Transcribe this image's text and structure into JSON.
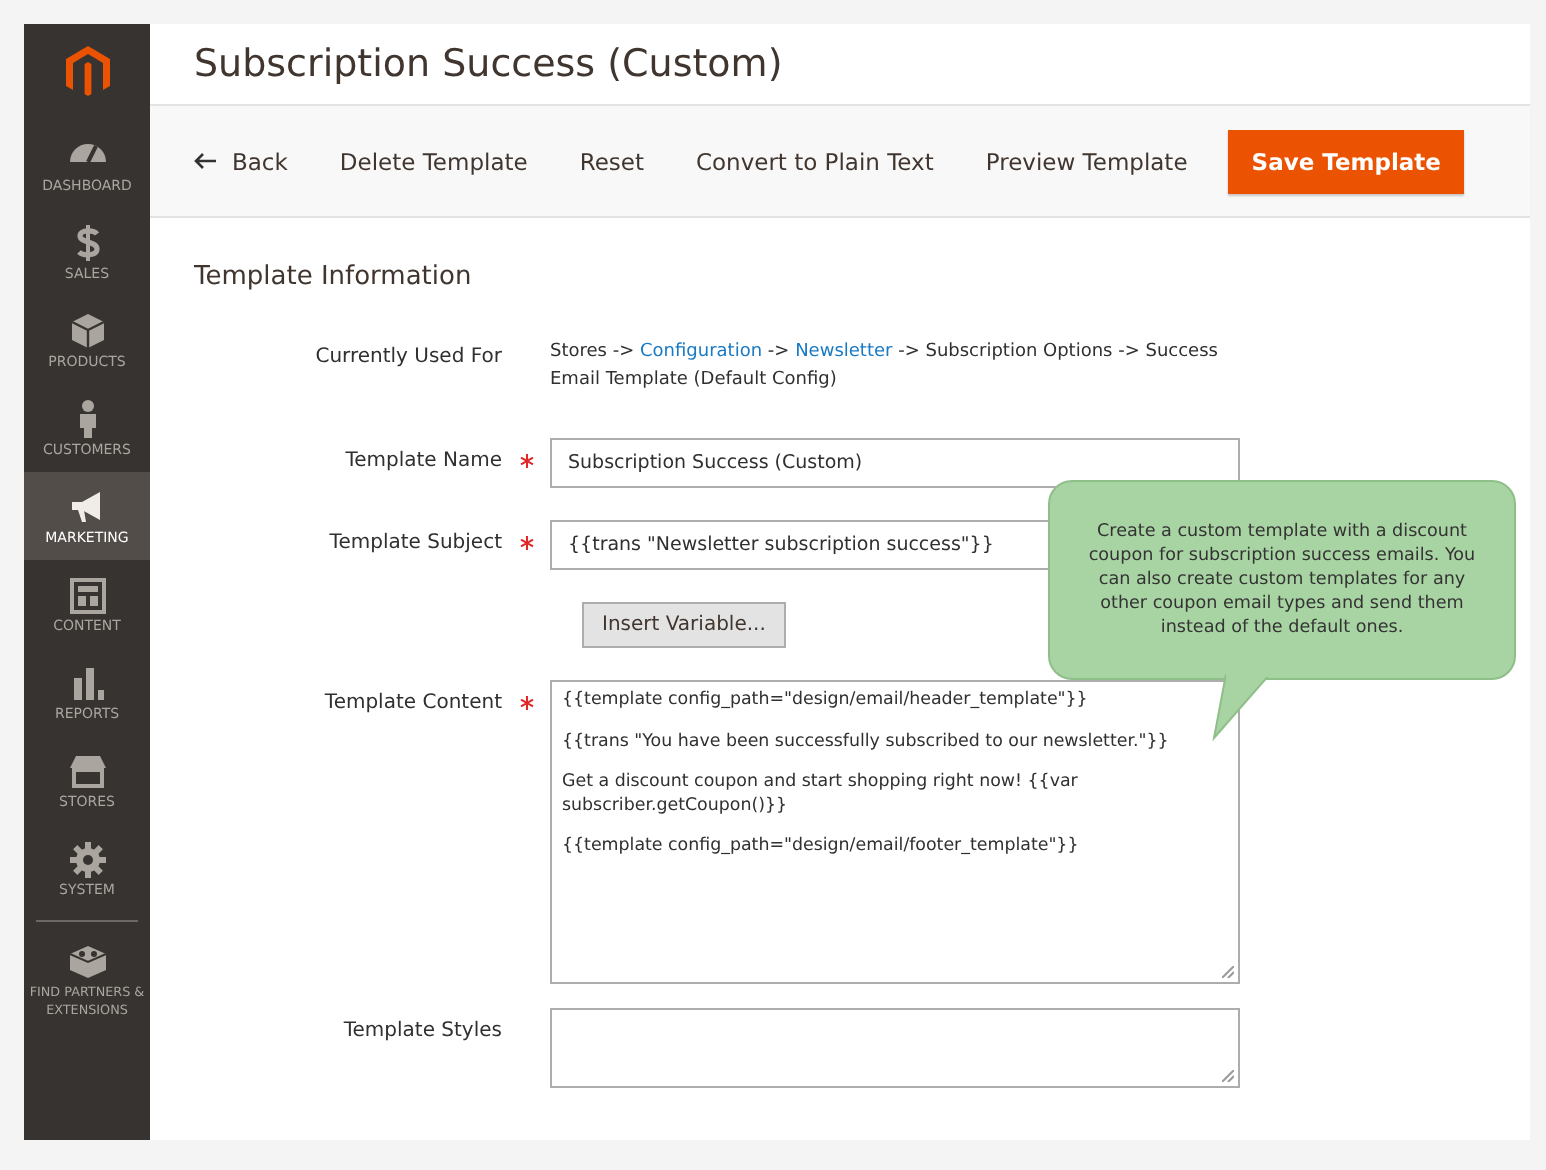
{
  "sidebar": {
    "items": [
      {
        "label": "DASHBOARD",
        "selected": false
      },
      {
        "label": "SALES",
        "selected": false
      },
      {
        "label": "PRODUCTS",
        "selected": false
      },
      {
        "label": "CUSTOMERS",
        "selected": false
      },
      {
        "label": "MARKETING",
        "selected": true
      },
      {
        "label": "CONTENT",
        "selected": false
      },
      {
        "label": "REPORTS",
        "selected": false
      },
      {
        "label": "STORES",
        "selected": false
      },
      {
        "label": "SYSTEM",
        "selected": false
      },
      {
        "label": "FIND PARTNERS & EXTENSIONS",
        "selected": false
      }
    ]
  },
  "page_title": "Subscription Success (Custom)",
  "toolbar": [
    {
      "label": "Back",
      "kind": "back"
    },
    {
      "label": "Delete Template",
      "kind": "plain"
    },
    {
      "label": "Reset",
      "kind": "plain"
    },
    {
      "label": "Convert to Plain Text",
      "kind": "plain"
    },
    {
      "label": "Preview Template",
      "kind": "plain"
    },
    {
      "label": "Save Template",
      "kind": "primary"
    }
  ],
  "section_title": "Template Information",
  "fields": [
    {
      "label": "Currently Used For",
      "kind": "info",
      "required": false,
      "parts": [
        {
          "text": "Stores -> ",
          "kind": "text"
        },
        {
          "text": "Configuration",
          "kind": "link"
        },
        {
          "text": " -> ",
          "kind": "text"
        },
        {
          "text": "Newsletter",
          "kind": "link"
        },
        {
          "text": " -> Subscription Options -> Success Email Template  (Default Config)",
          "kind": "text"
        }
      ]
    },
    {
      "label": "Template Name",
      "kind": "input",
      "required": true,
      "value": "Subscription Success (Custom)"
    },
    {
      "label": "Template Subject",
      "kind": "input",
      "required": true,
      "value": "{{trans \"Newsletter subscription success\"}}"
    },
    {
      "kind": "button",
      "label": "Insert Variable..."
    },
    {
      "label": "Template Content",
      "kind": "textarea",
      "required": true,
      "lines": [
        "{{template config_path=\"design/email/header_template\"}}",
        "{{trans \"You have been successfully subscribed to our newsletter.\"}}",
        "Get a discount coupon and start shopping right now! {{var subscriber.getCoupon()}}",
        "{{template config_path=\"design/email/footer_template\"}}"
      ]
    },
    {
      "label": "Template Styles",
      "kind": "styles",
      "required": false
    }
  ],
  "callout": {
    "text": "Create a custom template with a discount coupon for subscription success emails. You can also create custom templates for any other coupon email types and send them instead of the default ones."
  }
}
